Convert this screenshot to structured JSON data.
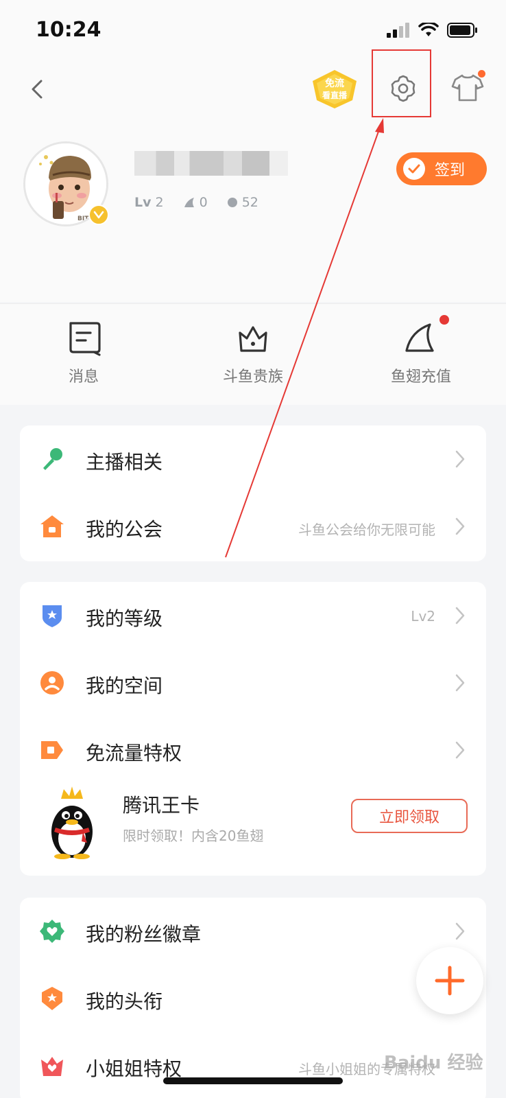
{
  "status_bar": {
    "time": "10:24"
  },
  "header": {
    "free_flow_badge_line1": "免流",
    "free_flow_badge_line2": "看直播",
    "signin_label": "签到",
    "stats": {
      "level_label": "Lv",
      "level_value": "2",
      "fin_count": "0",
      "coin_count": "52"
    },
    "avatar_cap_text": "BITCH"
  },
  "quick_actions": [
    {
      "label": "消息",
      "icon": "message-icon"
    },
    {
      "label": "斗鱼贵族",
      "icon": "crown-icon"
    },
    {
      "label": "鱼翅充值",
      "icon": "fin-icon",
      "has_dot": true
    }
  ],
  "card1": [
    {
      "label": "主播相关",
      "hint": "",
      "icon": "microphone-icon"
    },
    {
      "label": "我的公会",
      "hint": "斗鱼公会给你无限可能",
      "icon": "guild-house-icon"
    }
  ],
  "card2": [
    {
      "label": "我的等级",
      "hint": "Lv2",
      "icon": "level-shield-icon"
    },
    {
      "label": "我的空间",
      "hint": "",
      "icon": "person-circle-icon"
    },
    {
      "label": "免流量特权",
      "hint": "",
      "icon": "free-traffic-icon"
    }
  ],
  "promo": {
    "title": "腾讯王卡",
    "subtitle": "限时领取！内含20鱼翅",
    "button": "立即领取"
  },
  "card3": [
    {
      "label": "我的粉丝徽章",
      "hint": "",
      "icon": "fan-badge-icon"
    },
    {
      "label": "我的头衔",
      "hint": "",
      "icon": "title-badge-icon"
    },
    {
      "label": "小姐姐特权",
      "hint": "斗鱼小姐姐的专属特权",
      "icon": "lady-privilege-icon"
    }
  ],
  "watermark": "Baidu 经验",
  "colors": {
    "accent": "#ff7a2e",
    "annotation": "#e53935",
    "promo_button": "#e8553f"
  }
}
